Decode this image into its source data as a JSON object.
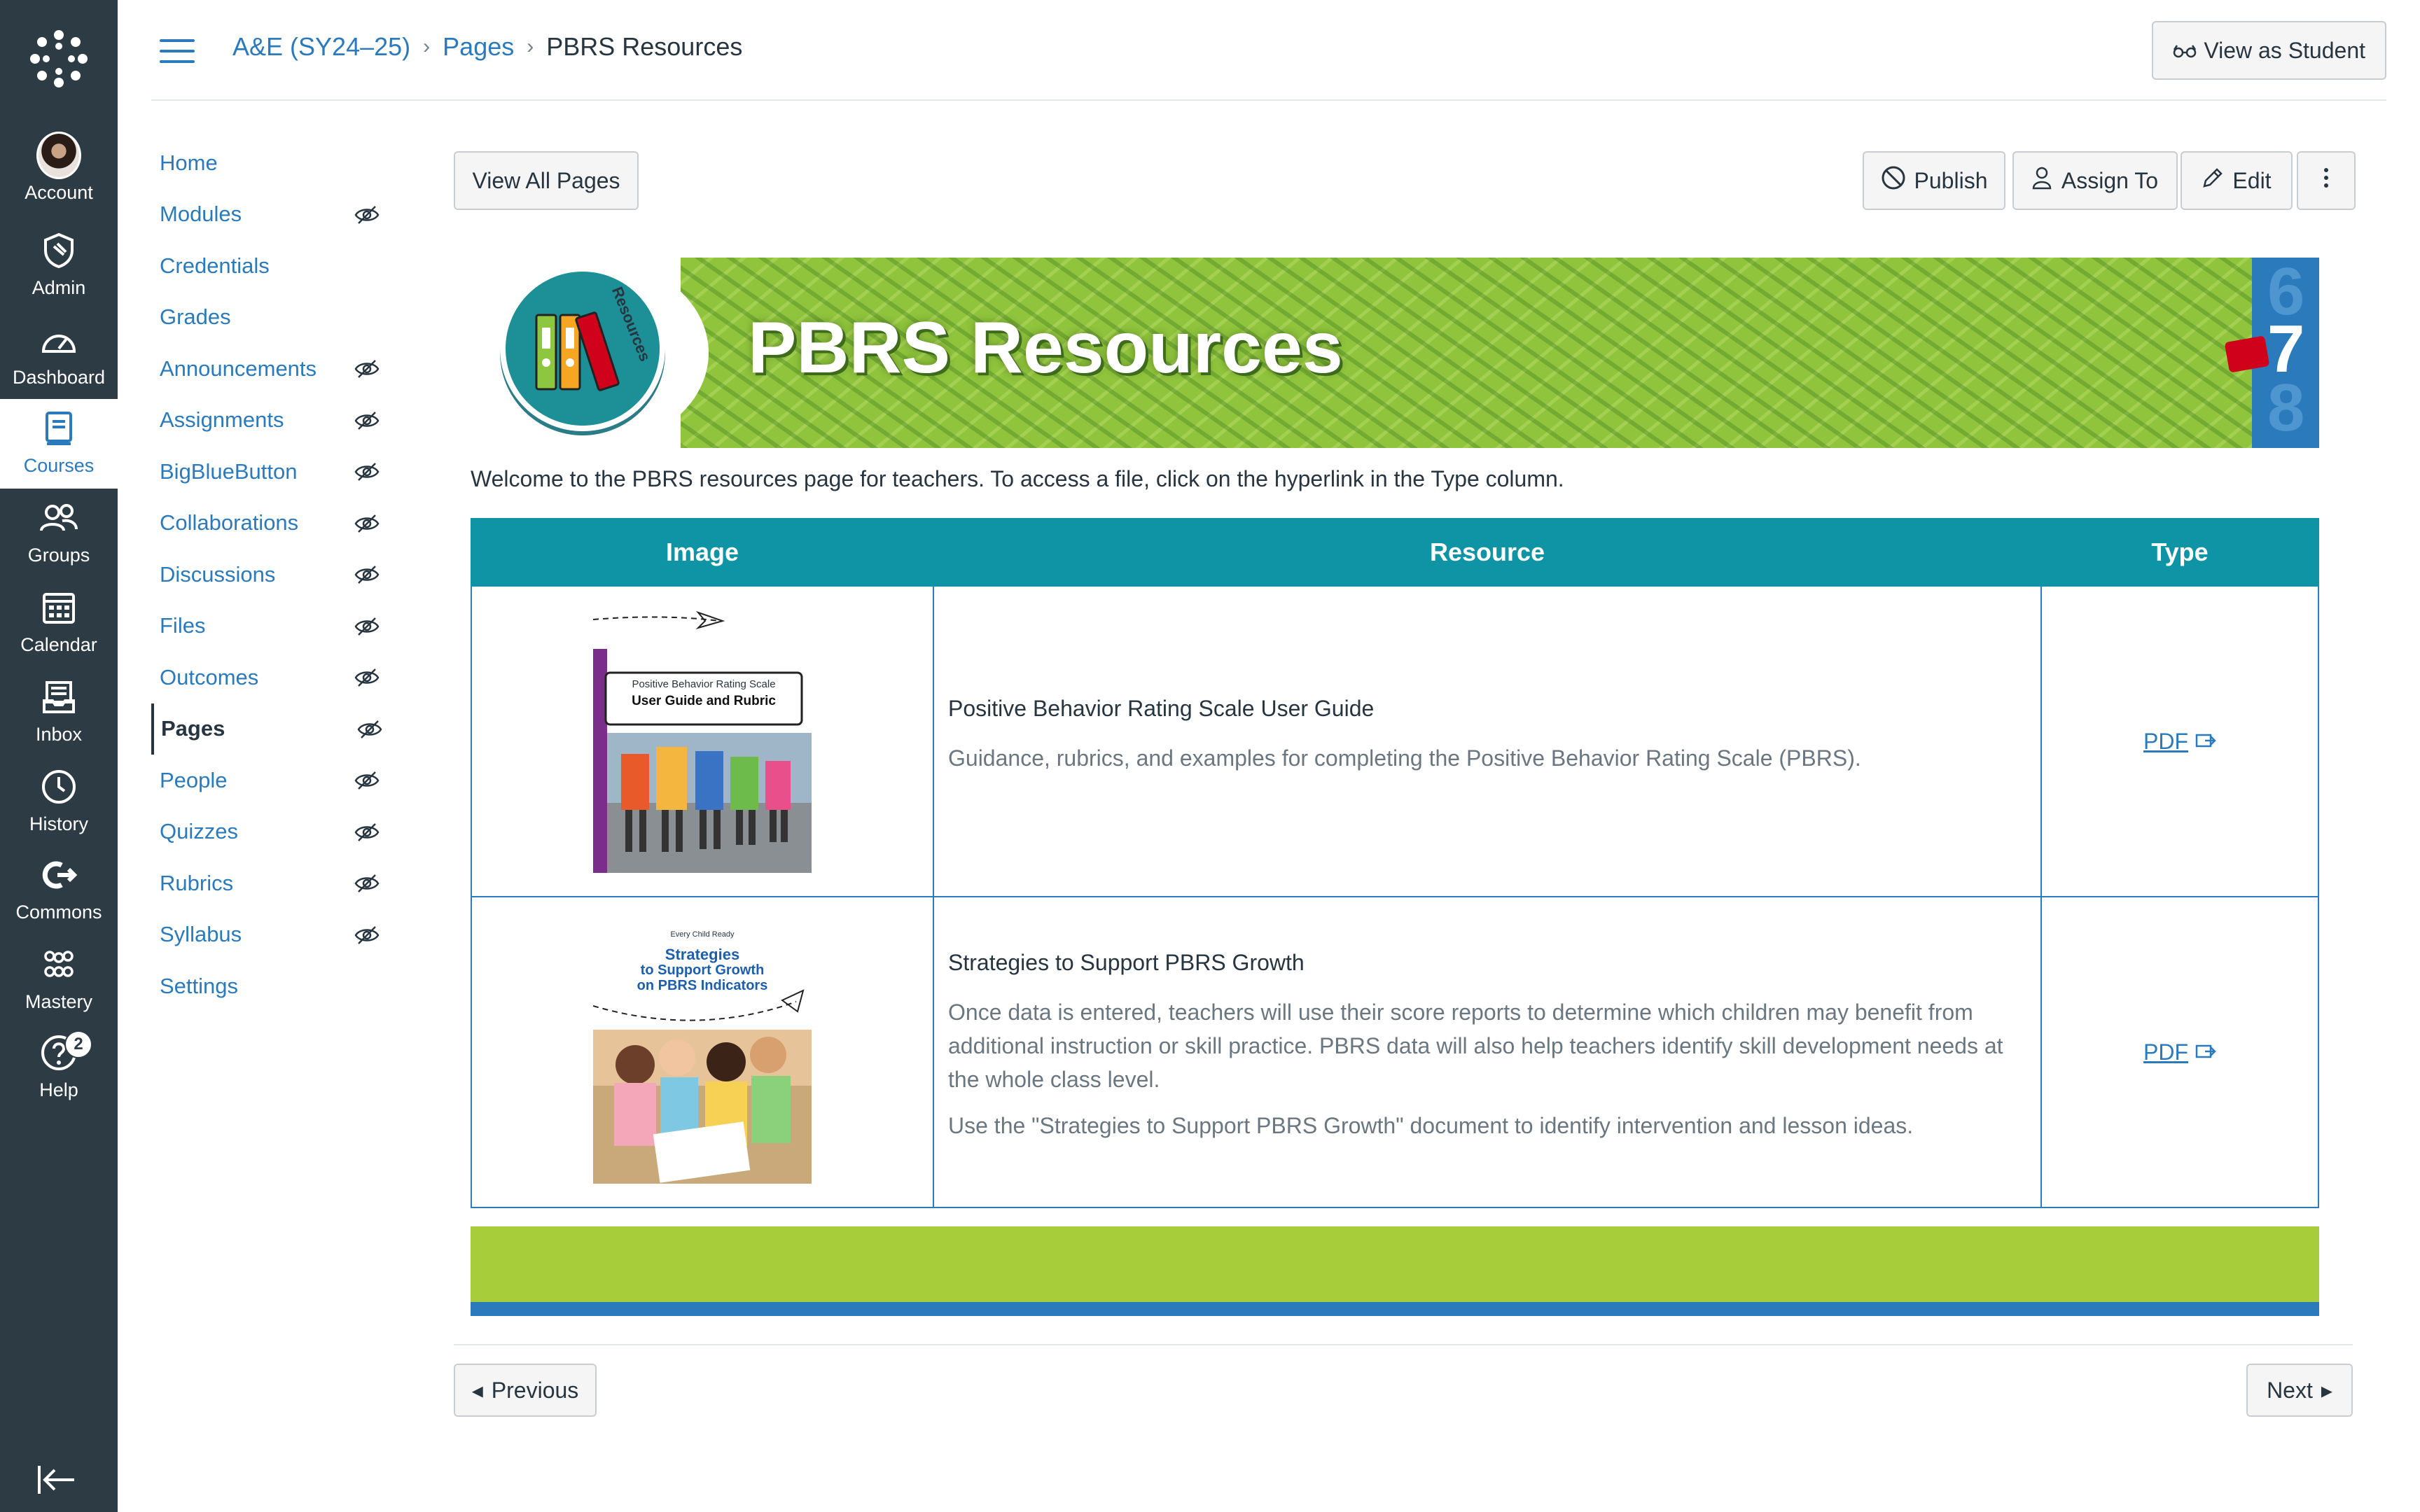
{
  "global_nav": {
    "items": [
      {
        "label": "Account",
        "icon": "avatar"
      },
      {
        "label": "Admin",
        "icon": "shield-icon"
      },
      {
        "label": "Dashboard",
        "icon": "dashboard-icon"
      },
      {
        "label": "Courses",
        "icon": "courses-icon"
      },
      {
        "label": "Groups",
        "icon": "groups-icon"
      },
      {
        "label": "Calendar",
        "icon": "calendar-icon"
      },
      {
        "label": "Inbox",
        "icon": "inbox-icon"
      },
      {
        "label": "History",
        "icon": "clock-icon"
      },
      {
        "label": "Commons",
        "icon": "commons-icon"
      },
      {
        "label": "Mastery",
        "icon": "mastery-icon"
      },
      {
        "label": "Help",
        "icon": "help-icon"
      }
    ],
    "help_badge": "2",
    "active": "Courses"
  },
  "header": {
    "breadcrumb": [
      "A&E (SY24–25)",
      "Pages",
      "PBRS Resources"
    ],
    "view_as_student": "View as Student"
  },
  "course_nav": {
    "items": [
      {
        "label": "Home",
        "hidden": false
      },
      {
        "label": "Modules",
        "hidden": true
      },
      {
        "label": "Credentials",
        "hidden": false
      },
      {
        "label": "Grades",
        "hidden": false
      },
      {
        "label": "Announcements",
        "hidden": true
      },
      {
        "label": "Assignments",
        "hidden": true
      },
      {
        "label": "BigBlueButton",
        "hidden": true
      },
      {
        "label": "Collaborations",
        "hidden": true
      },
      {
        "label": "Discussions",
        "hidden": true
      },
      {
        "label": "Files",
        "hidden": true
      },
      {
        "label": "Outcomes",
        "hidden": true
      },
      {
        "label": "Pages",
        "hidden": true
      },
      {
        "label": "People",
        "hidden": true
      },
      {
        "label": "Quizzes",
        "hidden": true
      },
      {
        "label": "Rubrics",
        "hidden": true
      },
      {
        "label": "Syllabus",
        "hidden": true
      },
      {
        "label": "Settings",
        "hidden": false
      }
    ],
    "active": "Pages"
  },
  "toolbar": {
    "view_all_pages": "View All Pages",
    "publish": "Publish",
    "assign_to": "Assign To",
    "edit": "Edit"
  },
  "banner": {
    "title": "PBRS Resources",
    "badge_text": "Resources",
    "grades": [
      "6",
      "7",
      "8"
    ]
  },
  "welcome": "Welcome to the PBRS resources page for teachers. To access a file, click on the hyperlink in the Type column.",
  "table": {
    "headers": [
      "Image",
      "Resource",
      "Type"
    ],
    "rows": [
      {
        "cover_title_1": "Positive Behavior Rating Scale",
        "cover_title_2": "User Guide and Rubric",
        "title": "Positive Behavior Rating Scale User Guide",
        "descriptions": [
          "Guidance, rubrics, and examples for completing the Positive Behavior Rating Scale (PBRS)."
        ],
        "type": "PDF"
      },
      {
        "cover_kicker": "Every Child Ready",
        "cover_title_1": "Strategies",
        "cover_title_2": "to Support Growth",
        "cover_title_3": "on PBRS Indicators",
        "title": "Strategies to Support PBRS Growth",
        "descriptions": [
          "Once data is entered, teachers will use their score reports to determine which children may benefit from additional instruction or skill practice. PBRS data will also help teachers identify skill development needs at the whole class level.",
          "Use the \"Strategies to Support PBRS Growth\" document to identify intervention and lesson ideas."
        ],
        "type": "PDF"
      }
    ]
  },
  "pagination": {
    "previous": "Previous",
    "next": "Next"
  },
  "colors": {
    "nav_bg": "#2d3b45",
    "link": "#2b7abc",
    "table_header": "#0e94a4",
    "banner_green": "#8fc43c",
    "footer_green": "#a8cd3a"
  }
}
